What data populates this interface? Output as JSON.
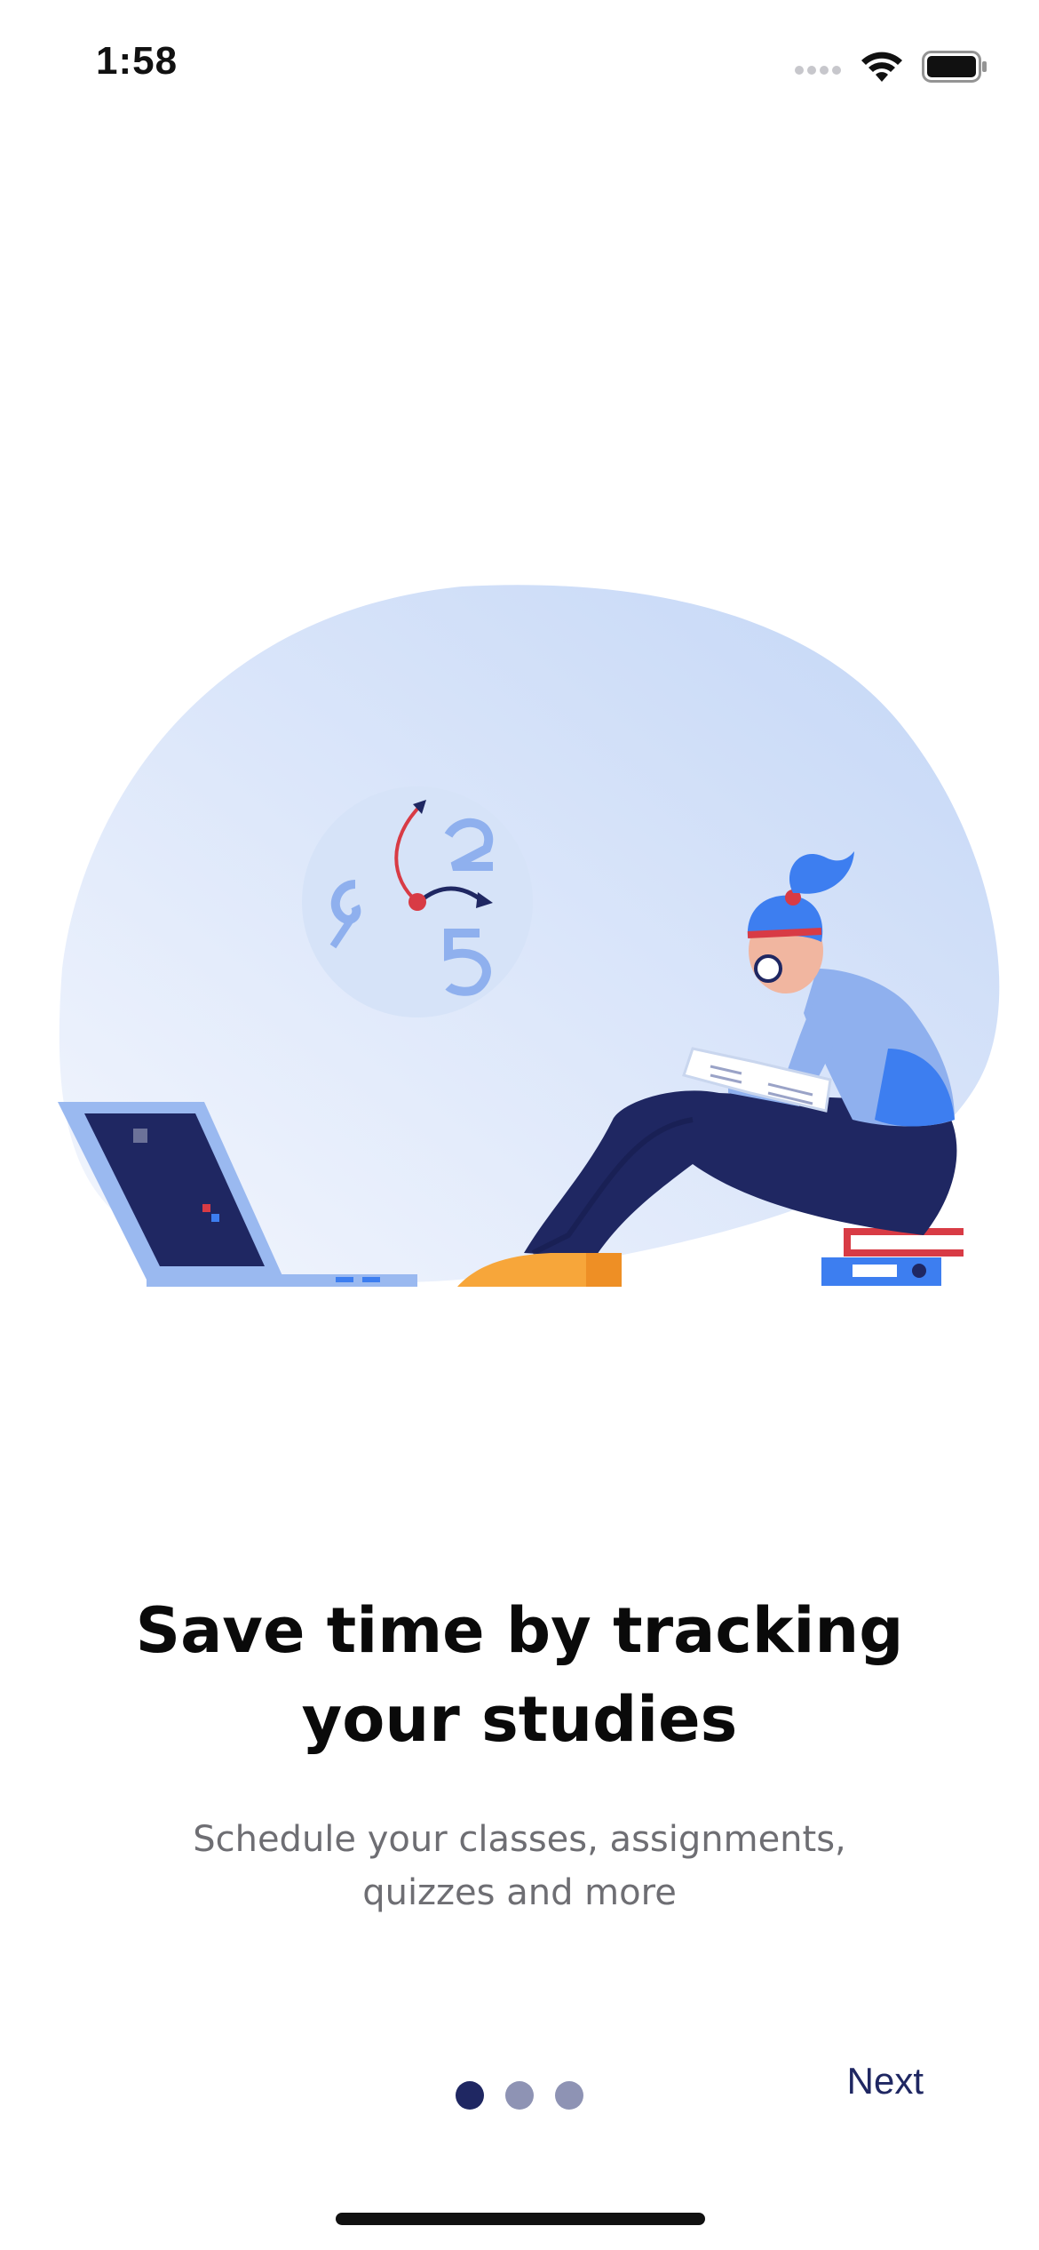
{
  "status_bar": {
    "time": "1:58"
  },
  "onboarding": {
    "title_line1": "Save time by tracking",
    "title_line2": "your studies",
    "subtitle_line1": "Schedule your classes, assignments,",
    "subtitle_line2": "quizzes and more",
    "next_label": "Next",
    "page_count": 3,
    "current_page": 1
  },
  "colors": {
    "accent": "#1f2762",
    "dot_inactive": "#8e93b4",
    "blob": "#c8d8f5",
    "subtitle": "#6e6e73"
  },
  "icons": [
    "signal-icon",
    "wifi-icon",
    "battery-icon"
  ]
}
